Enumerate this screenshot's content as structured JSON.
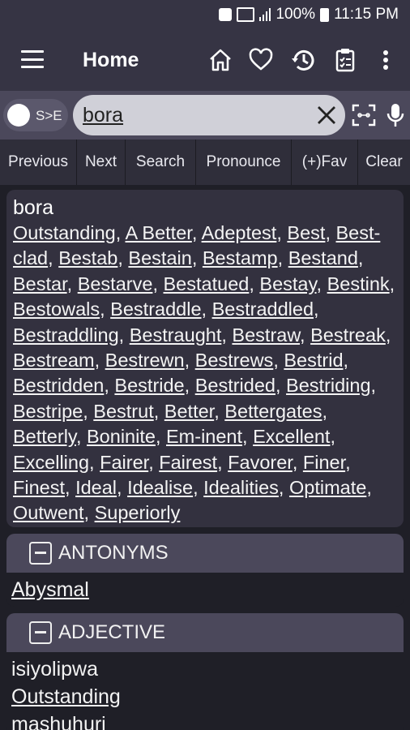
{
  "status_bar": {
    "battery": "100%",
    "time": "11:15 PM"
  },
  "app_bar": {
    "title": "Home",
    "icons": [
      "menu-icon",
      "home-icon",
      "heart-icon",
      "history-icon",
      "clipboard-icon",
      "more-vert-icon"
    ]
  },
  "search": {
    "toggle_label": "S>E",
    "query": "bora",
    "icons": [
      "close-icon",
      "scan-icon",
      "mic-icon"
    ]
  },
  "actions": [
    "Previous",
    "Next",
    "Search",
    "Pronounce",
    "(+)Fav",
    "Clear"
  ],
  "result": {
    "word": "bora",
    "synonyms": [
      "Outstanding",
      "A Better",
      "Adeptest",
      "Best",
      "Best-clad",
      "Bestab",
      "Bestain",
      "Bestamp",
      "Bestand",
      "Bestar",
      "Bestarve",
      "Bestatued",
      "Bestay",
      "Bestink",
      "Bestowals",
      "Bestraddle",
      "Bestraddled",
      "Bestraddling",
      "Bestraught",
      "Bestraw",
      "Bestreak",
      "Bestream",
      "Bestrewn",
      "Bestrews",
      "Bestrid",
      "Bestridden",
      "Bestride",
      "Bestrided",
      "Bestriding",
      "Bestripe",
      "Bestrut",
      "Better",
      "Bettergates",
      "Betterly",
      "Boninite",
      "Em-inent",
      "Excellent",
      "Excelling",
      "Fairer",
      "Fairest",
      "Favorer",
      "Finer",
      "Finest",
      "Ideal",
      "Idealise",
      "Idealities",
      "Optimate",
      "Outwent",
      "Superiorly"
    ]
  },
  "antonyms": {
    "heading": "ANTONYMS",
    "items": [
      "Abysmal"
    ]
  },
  "adjective": {
    "heading": "ADJECTIVE",
    "lines": [
      {
        "text": "isiyolipwa",
        "link": false
      },
      {
        "text": "Outstanding",
        "link": true
      },
      {
        "text": "mashuhuri",
        "link": false
      }
    ]
  },
  "colors": {
    "appbar": "#363444",
    "background": "#1f1f27",
    "card": "#33313f",
    "section_header": "#4b485b"
  }
}
